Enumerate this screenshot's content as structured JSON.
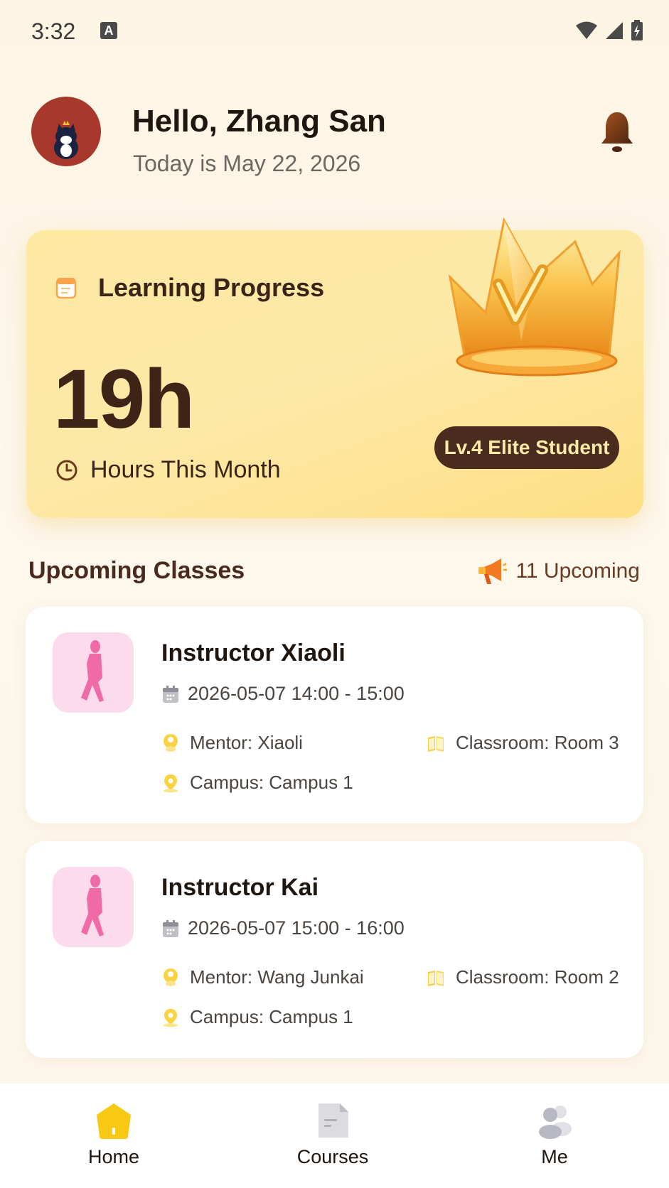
{
  "status_bar": {
    "time": "3:32",
    "input_indicator": "A",
    "icons": [
      "wifi-icon",
      "signal-icon",
      "battery-charging-icon"
    ]
  },
  "header": {
    "avatar": "cat-avatar",
    "greeting": "Hello, Zhang San",
    "date": "Today is May 22, 2026",
    "notification_icon": "bell-icon"
  },
  "progress": {
    "title": "Learning Progress",
    "hours": "19h",
    "hours_label": "Hours This Month",
    "level_badge": "Lv.4 Elite Student",
    "colors": {
      "card": "#fde9a7",
      "badge": "#4a2c1f",
      "text": "#3d2417"
    }
  },
  "upcoming": {
    "title": "Upcoming Classes",
    "count_label": "11 Upcoming",
    "classes": [
      {
        "instructor": "Instructor Xiaoli",
        "time": "2026-05-07 14:00 - 15:00",
        "mentor": "Mentor: Xiaoli",
        "classroom": "Classroom: Room 3",
        "campus": "Campus: Campus 1"
      },
      {
        "instructor": "Instructor Kai",
        "time": "2026-05-07 15:00 - 16:00",
        "mentor": "Mentor: Wang Junkai",
        "classroom": "Classroom: Room 2",
        "campus": "Campus: Campus 1"
      }
    ]
  },
  "nav": {
    "items": [
      {
        "label": "Home",
        "icon": "home-icon",
        "active": true
      },
      {
        "label": "Courses",
        "icon": "document-icon",
        "active": false
      },
      {
        "label": "Me",
        "icon": "users-icon",
        "active": false
      }
    ],
    "active_color": "#f8c812"
  }
}
